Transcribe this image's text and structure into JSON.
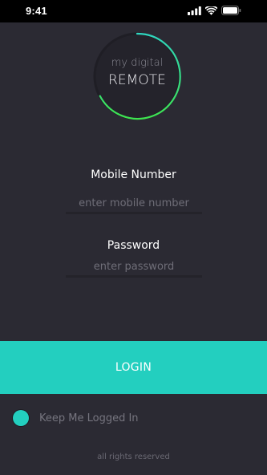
{
  "status_bar": {
    "time": "9:41"
  },
  "logo": {
    "line1": "my digital",
    "line2": "REMOTE"
  },
  "form": {
    "mobile": {
      "label": "Mobile Number",
      "placeholder": "enter mobile number",
      "value": ""
    },
    "password": {
      "label": "Password",
      "placeholder": "enter password",
      "value": ""
    }
  },
  "login_button": {
    "label": "LOGIN"
  },
  "keep_logged_in": {
    "label": "Keep Me Logged In",
    "checked": true
  },
  "footer": {
    "text": "all rights reserved"
  },
  "colors": {
    "background": "#2b2a33",
    "accent": "#23cfbf",
    "ring_gradient_start": "#2fd6c0",
    "ring_gradient_end": "#3ee34f"
  },
  "icons": [
    "signal-icon",
    "wifi-icon",
    "battery-icon"
  ]
}
